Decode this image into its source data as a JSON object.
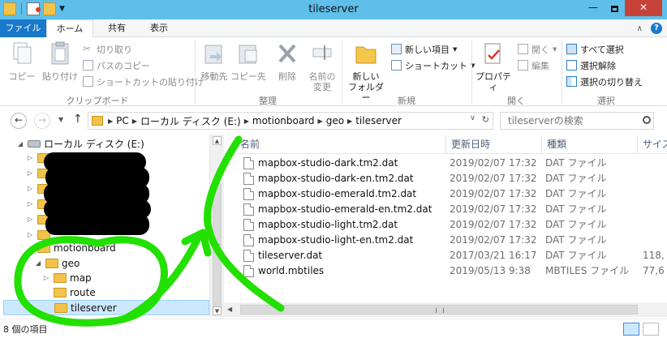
{
  "window": {
    "title": "tileserver",
    "controls": {
      "minimize": "—",
      "close": "✕"
    }
  },
  "ribbon": {
    "tabs": [
      {
        "label": "ファイル"
      },
      {
        "label": "ホーム"
      },
      {
        "label": "共有"
      },
      {
        "label": "表示"
      }
    ],
    "clipboard": {
      "label": "クリップボード",
      "copy": "コピー",
      "paste": "貼り付け",
      "cut": "切り取り",
      "copy_path": "パスのコピー",
      "paste_shortcut": "ショートカットの貼り付け"
    },
    "organize": {
      "label": "整理",
      "move_to": "移動先",
      "copy_to": "コピー先",
      "delete": "削除",
      "rename_line1": "名前の",
      "rename_line2": "変更"
    },
    "new": {
      "label": "新規",
      "new_folder_line1": "新しい",
      "new_folder_line2": "フォルダー",
      "new_item": "新しい項目",
      "shortcut": "ショートカット"
    },
    "open": {
      "label": "開く",
      "properties": "プロパティ",
      "open": "開く",
      "edit": "編集"
    },
    "select": {
      "label": "選択",
      "select_all": "すべて選択",
      "select_none": "選択解除",
      "invert": "選択の切り替え"
    }
  },
  "address": {
    "path": [
      "PC",
      "ローカル ディスク (E:)",
      "motionboard",
      "geo",
      "tileserver"
    ],
    "search_placeholder": "tileserverの検索"
  },
  "tree": {
    "drive": "ローカル ディスク (E:)",
    "motionboard": "motionboard",
    "geo": "geo",
    "map": "map",
    "route": "route",
    "tileserver": "tileserver"
  },
  "list": {
    "columns": {
      "name": "名前",
      "modified": "更新日時",
      "type": "種類",
      "size": "サイズ"
    },
    "files": [
      {
        "name": "mapbox-studio-dark.tm2.dat",
        "date": "2019/02/07 17:32",
        "type": "DAT ファイル",
        "size": ""
      },
      {
        "name": "mapbox-studio-dark-en.tm2.dat",
        "date": "2019/02/07 17:32",
        "type": "DAT ファイル",
        "size": ""
      },
      {
        "name": "mapbox-studio-emerald.tm2.dat",
        "date": "2019/02/07 17:32",
        "type": "DAT ファイル",
        "size": ""
      },
      {
        "name": "mapbox-studio-emerald-en.tm2.dat",
        "date": "2019/02/07 17:32",
        "type": "DAT ファイル",
        "size": ""
      },
      {
        "name": "mapbox-studio-light.tm2.dat",
        "date": "2019/02/07 17:32",
        "type": "DAT ファイル",
        "size": ""
      },
      {
        "name": "mapbox-studio-light-en.tm2.dat",
        "date": "2019/02/07 17:32",
        "type": "DAT ファイル",
        "size": ""
      },
      {
        "name": "tileserver.dat",
        "date": "2017/03/21 16:17",
        "type": "DAT ファイル",
        "size": "118,"
      },
      {
        "name": "world.mbtiles",
        "date": "2019/05/13 9:38",
        "type": "MBTILES ファイル",
        "size": "77,6"
      }
    ]
  },
  "status": {
    "item_count": "8 個の項目"
  },
  "annotation_color": "#22e000"
}
